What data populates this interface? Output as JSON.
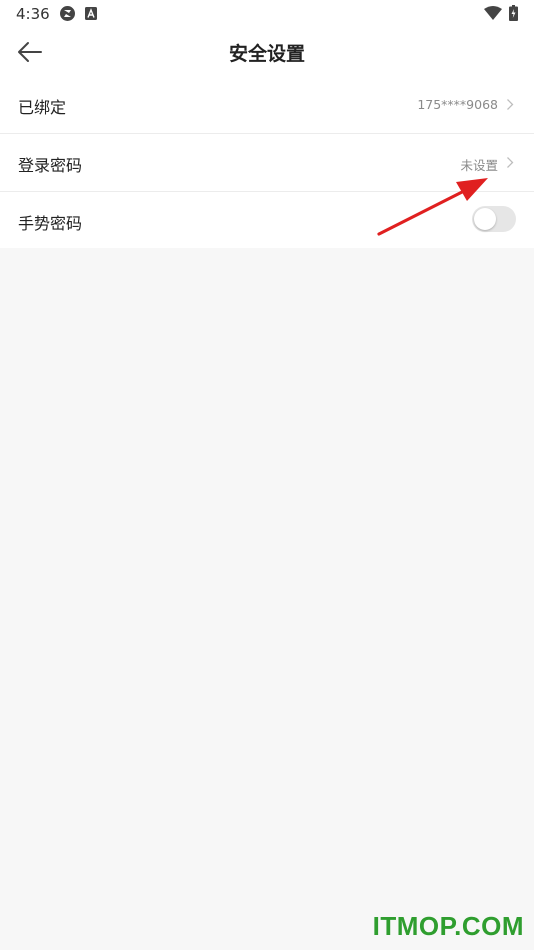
{
  "status_bar": {
    "time": "4:36",
    "icons": [
      "sync-icon",
      "a-icon",
      "wifi-icon",
      "battery-charging-icon"
    ]
  },
  "header": {
    "title": "安全设置",
    "back_icon": "arrow-left-icon"
  },
  "settings": [
    {
      "label": "已绑定",
      "value": "175****9068",
      "control": "chevron"
    },
    {
      "label": "登录密码",
      "value": "未设置",
      "control": "chevron"
    },
    {
      "label": "手势密码",
      "control": "toggle",
      "toggle_on": false
    }
  ],
  "annotation": {
    "type": "red-arrow",
    "color": "#e02020"
  },
  "watermark": "ITMOP.COM",
  "colors": {
    "background": "#f7f7f7",
    "surface": "#ffffff",
    "text_primary": "#222222",
    "text_secondary": "#8a8a8a",
    "watermark": "#2f9e2f"
  }
}
